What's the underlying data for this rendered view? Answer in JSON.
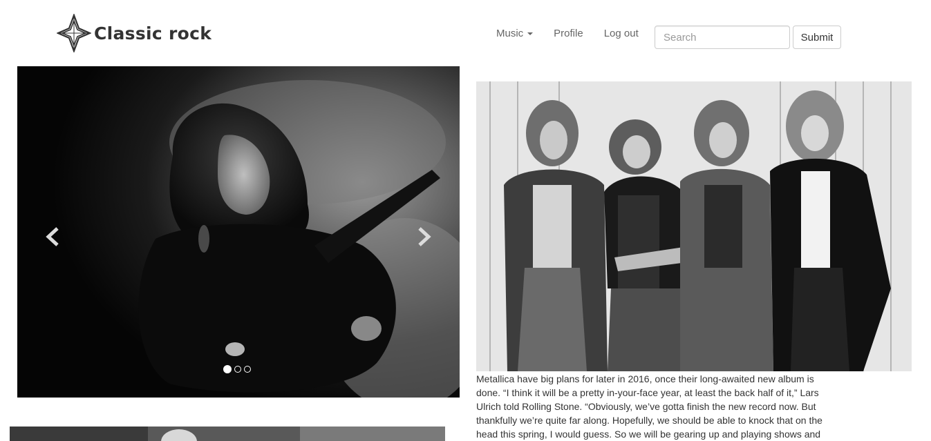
{
  "header": {
    "brand": "Classic rock",
    "logo_icon": "compass-star-icon"
  },
  "nav": {
    "music_label": "Music",
    "profile_label": "Profile",
    "logout_label": "Log out"
  },
  "search": {
    "placeholder": "Search",
    "value": "",
    "submit_label": "Submit"
  },
  "carousel": {
    "slide_count": 3,
    "active_slide": 1,
    "prev_icon": "chevron-left-icon",
    "next_icon": "chevron-right-icon"
  },
  "article": {
    "text": "Metallica have big plans for later in 2016, once their long-awaited new album is done. “I think it will be a pretty in-your-face year, at least the back half of it,” Lars Ulrich told Rolling Stone. “Obviously, we’ve gotta finish the new record now. But thankfully we’re quite far along. Hopefully, we should be able to knock that on the head this spring, I would guess. So we will be gearing up and playing shows and"
  }
}
